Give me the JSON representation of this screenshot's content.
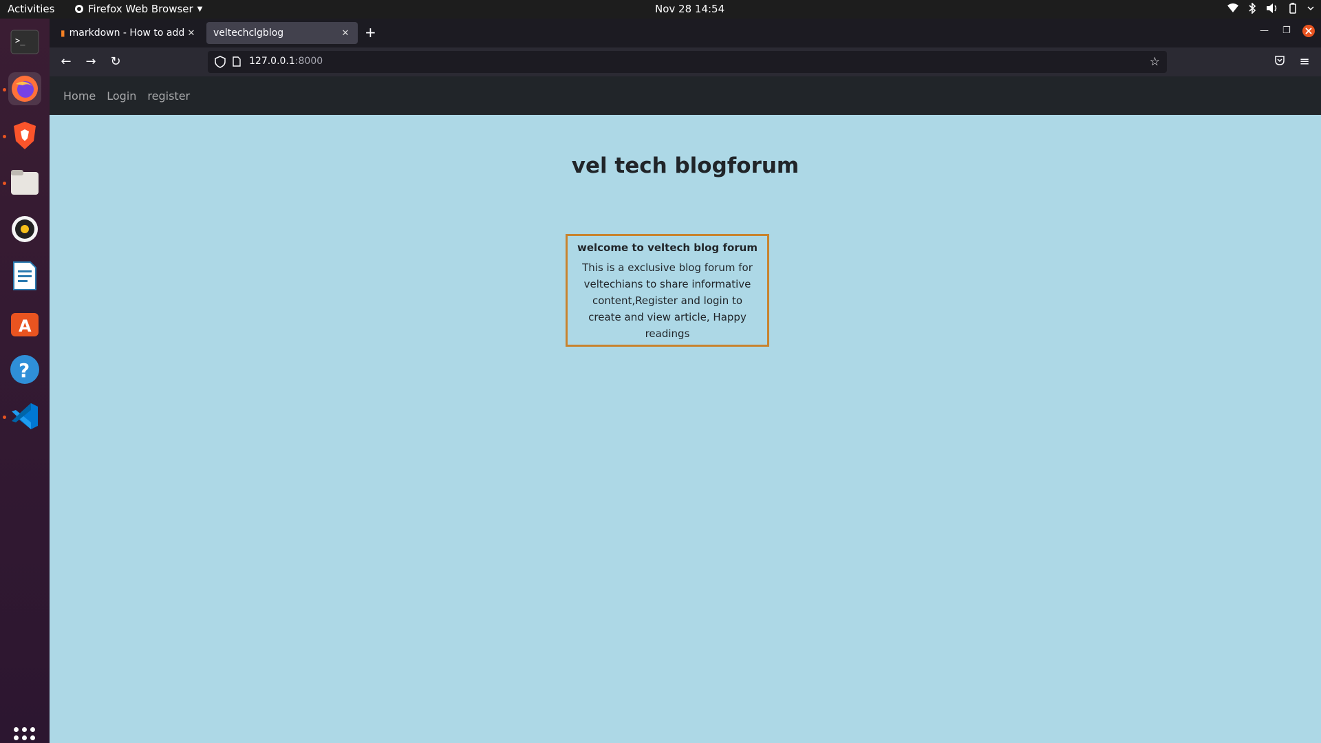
{
  "system": {
    "activities": "Activities",
    "app_menu": "Firefox Web Browser",
    "clock": "Nov 28  14:54"
  },
  "browser": {
    "tabs": [
      {
        "label": "markdown - How to add i",
        "active": false
      },
      {
        "label": "veltechclgblog",
        "active": true
      }
    ],
    "url_host": "127.0.0.1",
    "url_port": ":8000"
  },
  "site": {
    "nav": [
      "Home",
      "Login",
      "register"
    ],
    "heading": "vel tech blogforum",
    "card": {
      "title": "welcome to veltech blog forum",
      "body": "This is a exclusive blog forum for veltechians to share informative content,Register and login to create and view article, Happy readings"
    }
  },
  "dock": {
    "apps": [
      "terminal-icon",
      "firefox-icon",
      "brave-icon",
      "files-icon",
      "rhythmbox-icon",
      "writer-icon",
      "software-icon",
      "help-icon",
      "vscode-icon"
    ]
  },
  "colors": {
    "page_bg": "#add8e6",
    "navbar_bg": "#212529",
    "card_border": "#c8832e"
  }
}
